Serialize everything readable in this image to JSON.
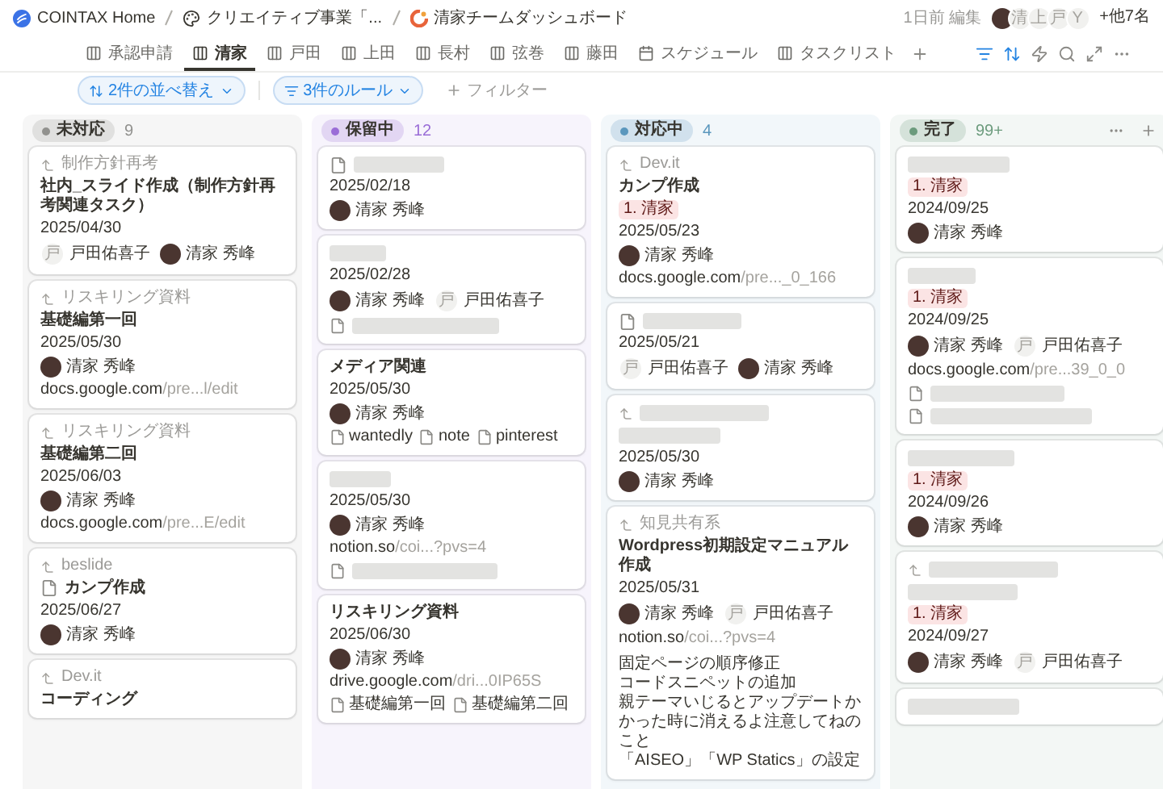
{
  "breadcrumbs": [
    {
      "text": "COINTAX Home"
    },
    {
      "text": "クリエイティブ事業「..."
    },
    {
      "text": "清家チームダッシュボード"
    }
  ],
  "edited": "1日前 編集",
  "collaborators": [
    {
      "kind": "photo"
    },
    {
      "kind": "letter",
      "text": "清"
    },
    {
      "kind": "letter",
      "text": "上"
    },
    {
      "kind": "letter",
      "text": "戸"
    },
    {
      "kind": "letter",
      "text": "Y"
    }
  ],
  "others": "+他7名",
  "tabs": [
    {
      "label": "承認申請",
      "kind": "board",
      "selected": false
    },
    {
      "label": "清家",
      "kind": "board",
      "selected": true
    },
    {
      "label": "戸田",
      "kind": "board",
      "selected": false
    },
    {
      "label": "上田",
      "kind": "board",
      "selected": false
    },
    {
      "label": "長村",
      "kind": "board",
      "selected": false
    },
    {
      "label": "弦巻",
      "kind": "board",
      "selected": false
    },
    {
      "label": "藤田",
      "kind": "board",
      "selected": false
    },
    {
      "label": "スケジュール",
      "kind": "calendar",
      "selected": false
    },
    {
      "label": "タスクリスト",
      "kind": "board",
      "selected": false
    }
  ],
  "sort_button": "2件の並べ替え",
  "rules_button": "3件のルール",
  "filter_button": "フィルター",
  "columns": [
    {
      "label": "未対応",
      "count": "9",
      "color": "#91918e",
      "menu": false,
      "cards": [
        {
          "lines": [
            {
              "kind": "parent",
              "text": "制作方針再考"
            },
            {
              "kind": "title",
              "text": "社内_スライド作成（制作方針再考関連タスク）",
              "page_icon": false
            },
            {
              "kind": "date",
              "text": "2025/04/30"
            },
            {
              "kind": "people",
              "people": [
                {
                  "name": "戸田佑喜子",
                  "initial": "戸"
                },
                {
                  "name": "清家 秀峰"
                }
              ]
            }
          ]
        },
        {
          "lines": [
            {
              "kind": "parent",
              "text": "リスキリング資料"
            },
            {
              "kind": "title",
              "text": "基礎編第一回",
              "page_icon": false
            },
            {
              "kind": "date",
              "text": "2025/05/30"
            },
            {
              "kind": "people",
              "people": [
                {
                  "name": "清家 秀峰"
                }
              ]
            },
            {
              "kind": "link",
              "domain": "docs.google.com",
              "rest": "/pre...l/edit"
            }
          ]
        },
        {
          "lines": [
            {
              "kind": "parent",
              "text": "リスキリング資料"
            },
            {
              "kind": "title",
              "text": "基礎編第二回",
              "page_icon": false
            },
            {
              "kind": "date",
              "text": "2025/06/03"
            },
            {
              "kind": "people",
              "people": [
                {
                  "name": "清家 秀峰"
                }
              ]
            },
            {
              "kind": "link",
              "domain": "docs.google.com",
              "rest": "/pre...E/edit"
            }
          ]
        },
        {
          "lines": [
            {
              "kind": "parent",
              "text": "beslide"
            },
            {
              "kind": "title",
              "text": "カンプ作成",
              "page_icon": true
            },
            {
              "kind": "date",
              "text": "2025/06/27"
            },
            {
              "kind": "people",
              "people": [
                {
                  "name": "清家 秀峰"
                }
              ]
            }
          ]
        },
        {
          "lines": [
            {
              "kind": "parent",
              "text": "Dev.it"
            },
            {
              "kind": "title",
              "text": "コーディング",
              "page_icon": false
            }
          ]
        }
      ]
    },
    {
      "label": "保留中",
      "count": "12",
      "color": "#9a6dd7",
      "menu": false,
      "cards": [
        {
          "lines": [
            {
              "kind": "hidden_title",
              "page_icon": true
            },
            {
              "kind": "date",
              "text": "2025/02/18"
            },
            {
              "kind": "people",
              "people": [
                {
                  "name": "清家 秀峰"
                }
              ]
            }
          ]
        },
        {
          "lines": [
            {
              "kind": "hidden_title",
              "page_icon": false
            },
            {
              "kind": "date",
              "text": "2025/02/28"
            },
            {
              "kind": "people",
              "people": [
                {
                  "name": "清家 秀峰"
                },
                {
                  "name": "戸田佑喜子",
                  "initial": "戸"
                }
              ]
            },
            {
              "kind": "hidden_file"
            }
          ]
        },
        {
          "lines": [
            {
              "kind": "title",
              "text": "メディア関連",
              "page_icon": false
            },
            {
              "kind": "date",
              "text": "2025/05/30"
            },
            {
              "kind": "people",
              "people": [
                {
                  "name": "清家 秀峰"
                }
              ]
            },
            {
              "kind": "files",
              "files": [
                "wantedly",
                "note",
                "pinterest"
              ]
            }
          ]
        },
        {
          "lines": [
            {
              "kind": "hidden_title",
              "page_icon": false
            },
            {
              "kind": "date",
              "text": "2025/05/30"
            },
            {
              "kind": "people",
              "people": [
                {
                  "name": "清家 秀峰"
                }
              ]
            },
            {
              "kind": "link",
              "domain": "notion.so",
              "rest": "/coi...?pvs=4"
            },
            {
              "kind": "hidden_file"
            }
          ]
        },
        {
          "lines": [
            {
              "kind": "title",
              "text": "リスキリング資料",
              "page_icon": false
            },
            {
              "kind": "date",
              "text": "2025/06/30"
            },
            {
              "kind": "people",
              "people": [
                {
                  "name": "清家 秀峰"
                }
              ]
            },
            {
              "kind": "link",
              "domain": "drive.google.com",
              "rest": "/dri...0IP65S"
            },
            {
              "kind": "files",
              "files": [
                "基礎編第一回",
                "基礎編第二回"
              ]
            }
          ]
        }
      ]
    },
    {
      "label": "対応中",
      "count": "4",
      "color": "#5b97bd",
      "menu": false,
      "cards": [
        {
          "lines": [
            {
              "kind": "parent",
              "text": "Dev.it"
            },
            {
              "kind": "title",
              "text": "カンプ作成",
              "page_icon": false
            },
            {
              "kind": "tag",
              "text": "1. 清家"
            },
            {
              "kind": "date",
              "text": "2025/05/23"
            },
            {
              "kind": "people",
              "people": [
                {
                  "name": "清家 秀峰"
                }
              ]
            },
            {
              "kind": "link",
              "domain": "docs.google.com",
              "rest": "/pre..._0_166"
            }
          ]
        },
        {
          "lines": [
            {
              "kind": "hidden_title",
              "page_icon": true
            },
            {
              "kind": "date",
              "text": "2025/05/21"
            },
            {
              "kind": "people",
              "people": [
                {
                  "name": "戸田佑喜子",
                  "initial": "戸"
                },
                {
                  "name": "清家 秀峰"
                }
              ]
            }
          ]
        },
        {
          "lines": [
            {
              "kind": "hidden_parent"
            },
            {
              "kind": "hidden_title",
              "page_icon": false
            },
            {
              "kind": "date",
              "text": "2025/05/30"
            },
            {
              "kind": "people",
              "people": [
                {
                  "name": "清家 秀峰"
                }
              ]
            }
          ]
        },
        {
          "lines": [
            {
              "kind": "parent",
              "text": "知見共有系"
            },
            {
              "kind": "title",
              "text": "Wordpress初期設定マニュアル作成",
              "page_icon": false
            },
            {
              "kind": "date",
              "text": "2025/05/31"
            },
            {
              "kind": "people",
              "people": [
                {
                  "name": "清家 秀峰"
                },
                {
                  "name": "戸田佑喜子",
                  "initial": "戸"
                }
              ]
            },
            {
              "kind": "link",
              "domain": "notion.so",
              "rest": "/coi...?pvs=4"
            },
            {
              "kind": "note",
              "lines": [
                "固定ページの順序修正",
                "コードスニペットの追加",
                "親テーマいじるとアップデートかかった時に消えるよ注意してねのこと",
                "「AISEO」「WP Statics」の設定"
              ]
            }
          ]
        }
      ]
    },
    {
      "label": "完了",
      "count": "99+",
      "color": "#6c9b7d",
      "menu": true,
      "cards": [
        {
          "lines": [
            {
              "kind": "hidden_title",
              "page_icon": false
            },
            {
              "kind": "tag",
              "text": "1. 清家"
            },
            {
              "kind": "date",
              "text": "2024/09/25"
            },
            {
              "kind": "people",
              "people": [
                {
                  "name": "清家 秀峰"
                }
              ]
            }
          ]
        },
        {
          "lines": [
            {
              "kind": "hidden_title",
              "page_icon": false
            },
            {
              "kind": "tag",
              "text": "1. 清家"
            },
            {
              "kind": "date",
              "text": "2024/09/25"
            },
            {
              "kind": "people",
              "people": [
                {
                  "name": "清家 秀峰"
                },
                {
                  "name": "戸田佑喜子",
                  "initial": "戸"
                }
              ]
            },
            {
              "kind": "link",
              "domain": "docs.google.com",
              "rest": "/pre...39_0_0"
            },
            {
              "kind": "hidden_file"
            },
            {
              "kind": "hidden_file"
            }
          ]
        },
        {
          "lines": [
            {
              "kind": "hidden_title",
              "page_icon": false
            },
            {
              "kind": "tag",
              "text": "1. 清家"
            },
            {
              "kind": "date",
              "text": "2024/09/26"
            },
            {
              "kind": "people",
              "people": [
                {
                  "name": "清家 秀峰"
                }
              ]
            }
          ]
        },
        {
          "lines": [
            {
              "kind": "hidden_parent"
            },
            {
              "kind": "hidden_title",
              "page_icon": false
            },
            {
              "kind": "tag",
              "text": "1. 清家"
            },
            {
              "kind": "date",
              "text": "2024/09/27"
            },
            {
              "kind": "people",
              "people": [
                {
                  "name": "清家 秀峰"
                },
                {
                  "name": "戸田佑喜子",
                  "initial": "戸"
                }
              ]
            }
          ]
        },
        {
          "lines": [
            {
              "kind": "hidden_title",
              "page_icon": false
            }
          ]
        }
      ]
    }
  ]
}
